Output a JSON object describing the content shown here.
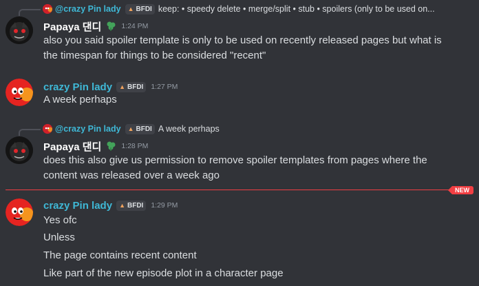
{
  "messages": [
    {
      "reply_to": {
        "username": "@crazy Pin lady",
        "tag": "BFDI",
        "text": "keep: • speedy delete  • merge/split  • stub  • spoilers (only to be used on..."
      },
      "username": "Papaya 댄디",
      "time": "1:24 PM",
      "text_lines": [
        "also you said spoiler template is only to be used on recently released pages but what is",
        "the timespan for things to be considered \"recent\""
      ]
    },
    {
      "username": "crazy Pin lady",
      "tag": "BFDI",
      "time": "1:27 PM",
      "text_lines": [
        "A week perhaps"
      ]
    },
    {
      "reply_to": {
        "username": "@crazy Pin lady",
        "tag": "BFDI",
        "text": "A week perhaps"
      },
      "username": "Papaya 댄디",
      "time": "1:28 PM",
      "text_lines": [
        "does this also give us permission to remove  spoiler templates from pages where the",
        "content was released over a week ago"
      ]
    },
    {
      "username": "crazy Pin lady",
      "tag": "BFDI",
      "time": "1:29 PM",
      "text_lines": [
        "Yes ofc",
        "Unless",
        "The page contains recent content",
        "Like part of the new episode plot in a character page"
      ]
    }
  ],
  "new_divider_label": "NEW",
  "colors": {
    "background": "#313338",
    "crazy_name": "#3fb8d6",
    "new_divider": "#f23f43",
    "flair_green": "#43a25a"
  }
}
